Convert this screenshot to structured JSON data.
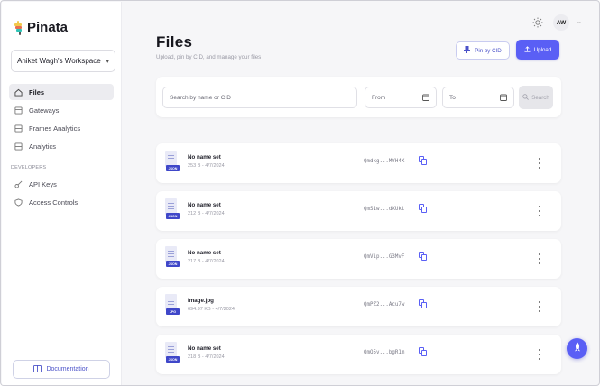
{
  "brand": {
    "name": "Pinata"
  },
  "sidebar": {
    "workspace": "Aniket Wagh's Workspace",
    "items": [
      {
        "label": "Files",
        "icon": "home-icon",
        "active": true
      },
      {
        "label": "Gateways",
        "icon": "gateway-icon",
        "active": false
      },
      {
        "label": "Frames Analytics",
        "icon": "frames-icon",
        "active": false
      },
      {
        "label": "Analytics",
        "icon": "analytics-icon",
        "active": false
      }
    ],
    "section_label": "DEVELOPERS",
    "dev_items": [
      {
        "label": "API Keys",
        "icon": "key-icon"
      },
      {
        "label": "Access Controls",
        "icon": "shield-icon"
      }
    ],
    "documentation_label": "Documentation"
  },
  "header": {
    "avatar_initials": "AW"
  },
  "main": {
    "title": "Files",
    "subtitle": "Upload, pin by CID, and manage your files",
    "pin_button": "Pin by CID",
    "upload_button": "Upload"
  },
  "search": {
    "placeholder": "Search by name or CID",
    "from_label": "From",
    "to_label": "To",
    "button": "Search"
  },
  "files": [
    {
      "name": "No name set",
      "size": "253 B",
      "date": "4/7/2024",
      "cid": "Qmdkg...MYH4X",
      "type": "JSON"
    },
    {
      "name": "No name set",
      "size": "212 B",
      "date": "4/7/2024",
      "cid": "QmS1w...dXUkt",
      "type": "JSON"
    },
    {
      "name": "No name set",
      "size": "217 B",
      "date": "4/7/2024",
      "cid": "QmVip...G3MvF",
      "type": "JSON"
    },
    {
      "name": "image.jpg",
      "size": "694.97 KB",
      "date": "4/7/2024",
      "cid": "QmPZ2...Acu7w",
      "type": "JPG"
    },
    {
      "name": "No name set",
      "size": "218 B",
      "date": "4/7/2024",
      "cid": "QmQ5v...bgR1m",
      "type": "JSON"
    }
  ],
  "colors": {
    "accent": "#5a5ff5",
    "accent_dark": "#3f47c9"
  }
}
